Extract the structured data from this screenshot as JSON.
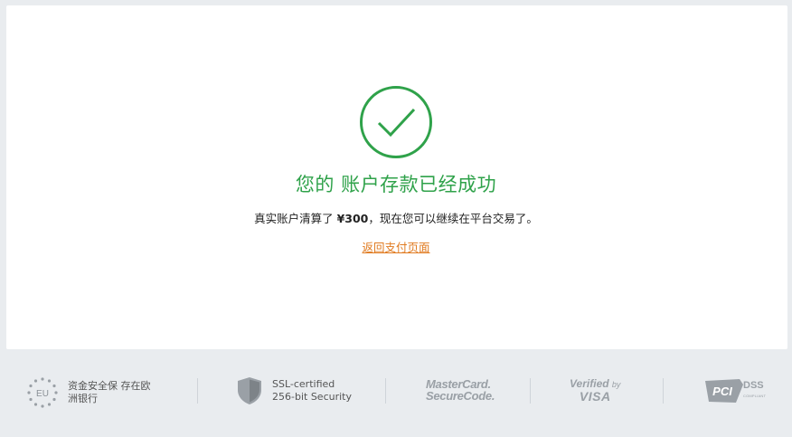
{
  "success": {
    "title": "您的 账户存款已经成功",
    "message_prefix": "真实账户清算了 ",
    "amount": "¥300",
    "message_suffix": "，现在您可以继续在平台交易了。",
    "back_link_label": "返回支付页面"
  },
  "colors": {
    "success_green": "#2fa24a",
    "link_orange": "#e07a1f",
    "page_bg": "#e9ecef"
  },
  "footer": {
    "eu_badge": {
      "icon_text": "EU",
      "label_line1": "资金安全保 存在欧",
      "label_line2": "洲银行"
    },
    "ssl_badge": {
      "label_line1": "SSL-certified",
      "label_line2": "256-bit Security"
    },
    "mastercard_badge": {
      "line1": "MasterCard.",
      "line2": "SecureCode."
    },
    "visa_badge": {
      "line1": "Verified",
      "line1_small": "by",
      "line2": "VISA"
    },
    "pci_badge": {
      "mark": "PCI",
      "dss": "DSS",
      "compliant": "COMPLIANT"
    }
  }
}
